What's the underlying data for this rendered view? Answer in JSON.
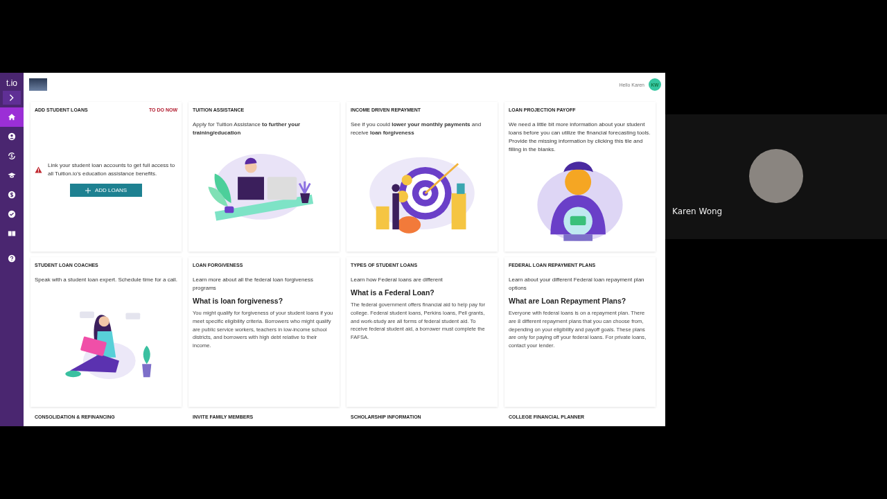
{
  "sidebar": {
    "logo": "t.io",
    "items": [
      {
        "kind": "expand",
        "selected": false
      },
      {
        "kind": "home",
        "selected": true
      },
      {
        "kind": "profile",
        "selected": false
      },
      {
        "kind": "refinance",
        "selected": false
      },
      {
        "kind": "education",
        "selected": false
      },
      {
        "kind": "money",
        "selected": false
      },
      {
        "kind": "tasks",
        "selected": false
      },
      {
        "kind": "library",
        "selected": false
      },
      {
        "kind": "help",
        "selected": false
      }
    ]
  },
  "header": {
    "greeting": "Hello Karen",
    "avatar_initials": "KW"
  },
  "cards": [
    {
      "kind": "todo",
      "title": "ADD STUDENT LOANS",
      "status": "TO DO NOW",
      "message": "Link your student loan accounts to get full access to all Tuition.io's education assistance benefits.",
      "button": "ADD LOANS"
    },
    {
      "kind": "illustrated",
      "title": "TUITION ASSISTANCE",
      "text": "Apply for Tuition Assistance **to further your training/education**"
    },
    {
      "kind": "illustrated",
      "title": "INCOME DRIVEN REPAYMENT",
      "text": "See if you could **lower your monthly payments** and receive **loan forgiveness**"
    },
    {
      "kind": "illustrated",
      "title": "LOAN PROJECTION PAYOFF",
      "text": "We need a little bit more information about your student loans before you can utilize the financial forecasting tools. Provide the missing information by clicking this tile and filling in the blanks."
    },
    {
      "kind": "illustrated",
      "title": "STUDENT LOAN COACHES",
      "text": "Speak with a student loan expert. Schedule time for a call."
    },
    {
      "kind": "article",
      "title": "LOAN FORGIVENESS",
      "text": "Learn more about all the federal loan forgiveness programs",
      "heading": "What is loan forgiveness?",
      "body": "You might qualify for forgiveness of your student loans if you meet specific eligibility criteria. Borrowers who might qualify are public service workers, teachers in low-income school districts, and borrowers with high debt relative to their income."
    },
    {
      "kind": "article",
      "title": "TYPES OF STUDENT LOANS",
      "text": "Learn how Federal loans are different",
      "heading": "What is a Federal Loan?",
      "body": "The federal government offers financial aid to help pay for college. Federal student loans, Perkins loans, Pell grants, and work-study are all forms of federal student aid. To receive federal student aid, a borrower must complete the FAFSA."
    },
    {
      "kind": "article",
      "title": "FEDERAL LOAN REPAYMENT PLANS",
      "text": "Learn about your different Federal loan repayment plan options",
      "heading": "What are Loan Repayment Plans?",
      "body": "Everyone with federal loans is on a repayment plan. There are 8 different repayment plans that you can choose from, depending on your eligibility and payoff goals. These plans are only for paying off your federal loans. For private loans, contact your lender."
    },
    {
      "kind": "collapsed",
      "title": "CONSOLIDATION & REFINANCING"
    },
    {
      "kind": "collapsed",
      "title": "INVITE FAMILY MEMBERS"
    },
    {
      "kind": "collapsed",
      "title": "SCHOLARSHIP INFORMATION"
    },
    {
      "kind": "collapsed",
      "title": "COLLEGE FINANCIAL PLANNER"
    }
  ],
  "participant": {
    "name": "Karen Wong"
  }
}
